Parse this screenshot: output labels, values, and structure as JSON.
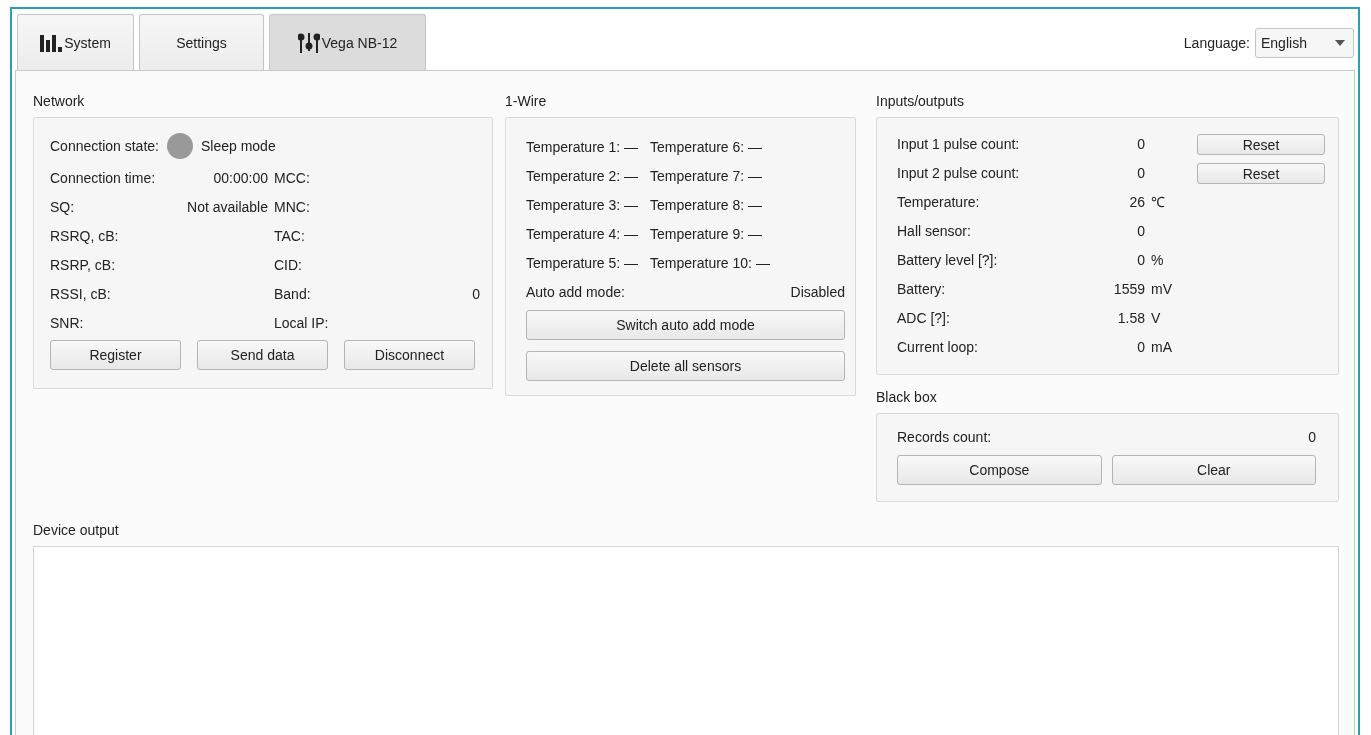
{
  "tabs": [
    {
      "label": "System",
      "kind": "bars",
      "selected": false
    },
    {
      "label": "Settings",
      "kind": "plain",
      "selected": false
    },
    {
      "label": "Vega NB-12",
      "kind": "sliders",
      "selected": true
    }
  ],
  "language": {
    "label": "Language:",
    "value": "English"
  },
  "network": {
    "title": "Network",
    "connection": {
      "label": "Connection state:",
      "color": "#999999",
      "value": "Sleep mode"
    },
    "rows": [
      {
        "label": "Connection time:",
        "value": "00:00:00",
        "label_2": "MCC:"
      },
      {
        "label": "SQ:",
        "value": "Not available",
        "label_2": "MNC:"
      },
      {
        "label": "RSRQ, cB:",
        "label_2": "TAC:"
      },
      {
        "label": "RSRP, cB:",
        "label_2": "CID:"
      },
      {
        "label": "RSSI, cB:",
        "label_2": "Band:",
        "value_2": "0"
      },
      {
        "label": "SNR:",
        "label_2": "Local IP:"
      }
    ],
    "buttons": [
      "Register",
      "Send data",
      "Disconnect"
    ]
  },
  "one_wire": {
    "title": "1-Wire",
    "sensors": [
      "Temperature 1: —",
      "Temperature 2: —",
      "Temperature 3: —",
      "Temperature 4: —",
      "Temperature 5: —",
      "Temperature 6: —",
      "Temperature 7: —",
      "Temperature 8: —",
      "Temperature 9: —",
      "Temperature 10: —"
    ],
    "auto_add": {
      "label": "Auto add mode:",
      "value": "Disabled"
    },
    "buttons": [
      "Switch auto add mode",
      "Delete all sensors"
    ]
  },
  "inputs_outputs": {
    "title": "Inputs/outputs",
    "rows": [
      {
        "label": "Input 1 pulse count:",
        "value": "0",
        "button": "Reset"
      },
      {
        "label": "Input 2 pulse count:",
        "value": "0",
        "button": "Reset"
      },
      {
        "label": "Temperature:",
        "value": "26",
        "unit": "℃"
      },
      {
        "label": "Hall sensor:",
        "value": "0"
      },
      {
        "label": "Battery level [?]:",
        "value": "0",
        "unit": "%"
      },
      {
        "label": "Battery:",
        "value": "1559",
        "unit": "mV"
      },
      {
        "label": "ADC [?]:",
        "value": "1.58",
        "unit": "V"
      },
      {
        "label": "Current loop:",
        "value": "0",
        "unit": "mA"
      }
    ]
  },
  "black_box": {
    "title": "Black box",
    "label": "Records count:",
    "value": "0",
    "buttons": [
      "Compose",
      "Clear"
    ]
  },
  "device_output": {
    "title": "Device output"
  }
}
